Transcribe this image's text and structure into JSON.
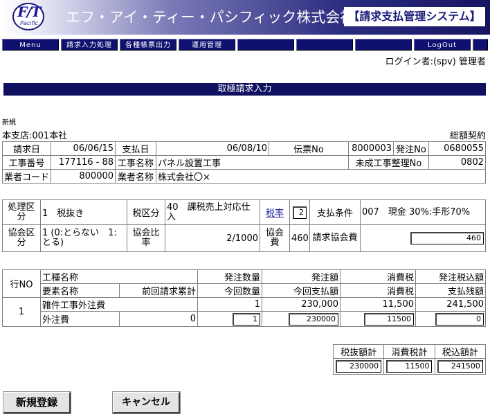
{
  "header": {
    "logo_main": "F/T",
    "logo_sub": "Pacific",
    "company": "エフ・アイ・ティー・パシフィック株式会社",
    "system": "【請求支払管理システム】"
  },
  "menu": {
    "items": [
      "Menu",
      "請求入力処理",
      "各種帳票出力",
      "運用管理",
      "",
      "",
      "",
      "LogOut",
      ""
    ]
  },
  "login": "ログイン者:(spv) 管理者",
  "page_title": "取極請求入力",
  "mode": "新規",
  "branch": "本支店:001本社",
  "contract_type": "総額契約",
  "info": {
    "billing_date_label": "請求日",
    "billing_date": "06/06/15",
    "payment_date_label": "支払日",
    "payment_date": "06/08/10",
    "slip_no_label": "伝票No",
    "slip_no": "8000003",
    "order_no_label": "発注No",
    "order_no": "0680055",
    "work_no_label": "工事番号",
    "work_no": "177116 - 88",
    "work_name_label": "工事名称",
    "work_name": "パネル設置工事",
    "unfinished_label": "未成工事整理No",
    "unfinished_no": "0802",
    "vendor_code_label": "業者コード",
    "vendor_code": "800000",
    "vendor_name_label": "業者名称",
    "vendor_name": "株式会社〇×"
  },
  "tax": {
    "proc_label": "処理区分",
    "proc_value": "1　税抜き",
    "tax_class_label": "税区分",
    "tax_class_value": "40　課税売上対応仕入",
    "rate_label": "税率",
    "rate_value": "2",
    "terms_label": "支払条件",
    "terms_value": "007　現金 30%:手形70%",
    "assoc_label": "協会区分",
    "assoc_value": "1 (0:とらない　1:とる)",
    "assoc_ratio_label": "協会比率",
    "assoc_ratio_value": "2/1000",
    "assoc_fee_label": "協会費",
    "assoc_fee_value": "460",
    "billing_assoc_label": "請求協会費",
    "billing_assoc_value": "460"
  },
  "detail": {
    "h_row": "行NO",
    "h_work_type": "工種名称",
    "h_order_qty": "発注数量",
    "h_order_amt": "発注額",
    "h_tax": "消費税",
    "h_order_total": "発注税込額",
    "h_element": "要素名称",
    "h_prev_total": "前回請求累計",
    "h_cur_qty": "今回数量",
    "h_cur_pay": "今回支払額",
    "h_tax2": "消費税",
    "h_balance": "支払残額",
    "rows": [
      {
        "no": "1",
        "work_type": "雑件工事外注費",
        "order_qty": "1",
        "order_amt": "230,000",
        "tax": "11,500",
        "order_total": "241,500",
        "element": "外注費",
        "prev_total": "0",
        "cur_qty": "1",
        "cur_pay": "230000",
        "cur_tax": "11500",
        "balance": "0"
      }
    ]
  },
  "totals": {
    "excl_label": "税抜額計",
    "tax_label": "消費税計",
    "incl_label": "税込額計",
    "excl": "230000",
    "tax": "11500",
    "incl": "241500"
  },
  "buttons": {
    "register": "新規登録",
    "cancel": "キャンセル"
  }
}
